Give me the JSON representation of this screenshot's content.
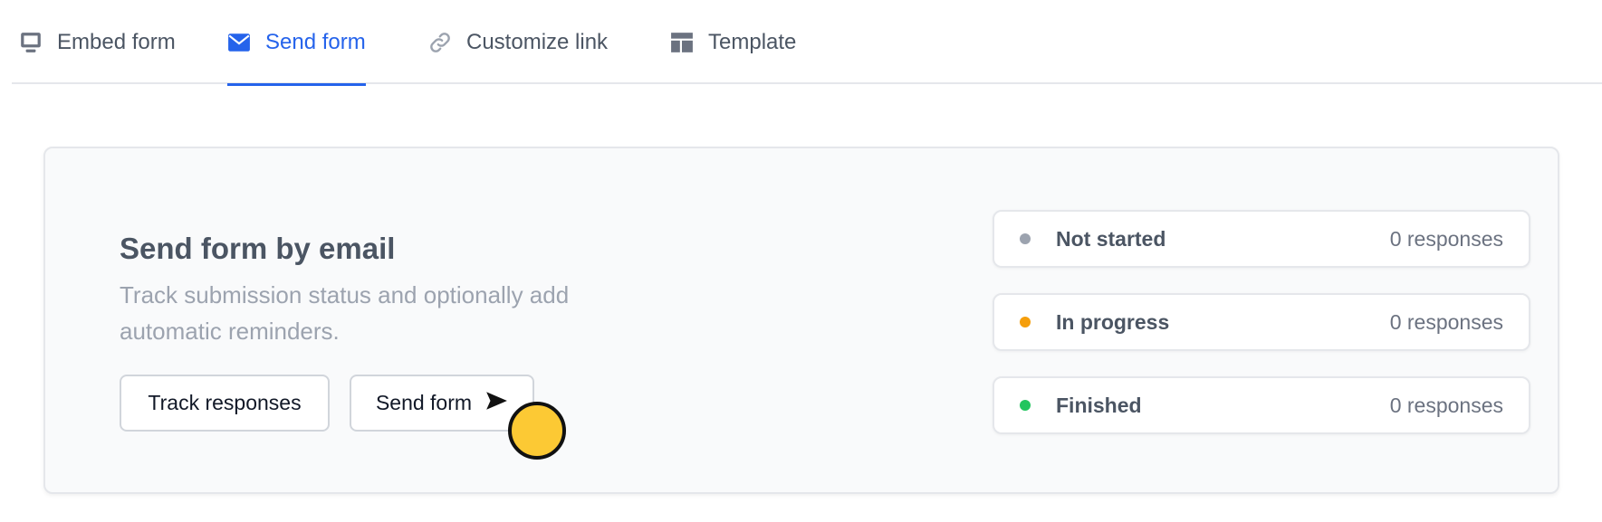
{
  "tabs": [
    {
      "label": "Embed form",
      "icon": "monitor-icon",
      "active": false
    },
    {
      "label": "Send form",
      "icon": "envelope-icon",
      "active": true
    },
    {
      "label": "Customize link",
      "icon": "link-icon",
      "active": false
    },
    {
      "label": "Template",
      "icon": "layout-template-icon",
      "active": false
    }
  ],
  "card": {
    "title": "Send form by email",
    "description": "Track submission status and optionally add automatic reminders.",
    "track_button": "Track responses",
    "send_button": "Send form"
  },
  "statuses": [
    {
      "label": "Not started",
      "count": "0 responses",
      "color": "#9ca3af"
    },
    {
      "label": "In progress",
      "count": "0 responses",
      "color": "#f59e0b"
    },
    {
      "label": "Finished",
      "count": "0 responses",
      "color": "#22c55e"
    }
  ],
  "colors": {
    "accent": "#2563eb",
    "cursor": "#fcc934"
  }
}
